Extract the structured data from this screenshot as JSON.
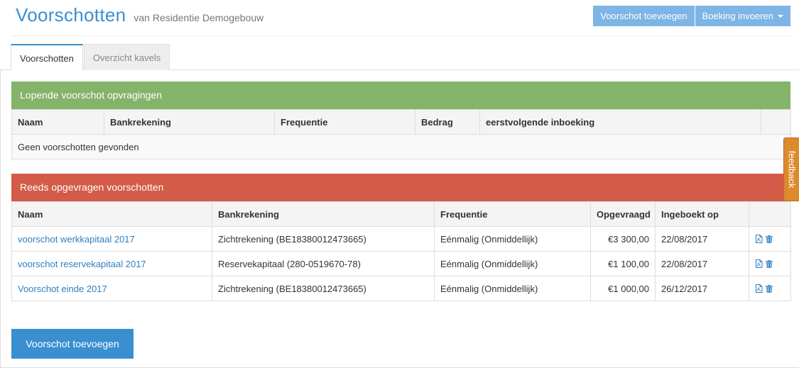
{
  "header": {
    "title": "Voorschotten",
    "subtitle": "van Residentie Demogebouw",
    "add_button": "Voorschot toevoegen",
    "booking_button": "Boeking invoeren"
  },
  "tabs": [
    {
      "label": "Voorschotten",
      "active": true
    },
    {
      "label": "Overzicht kavels",
      "active": false
    }
  ],
  "running": {
    "title": "Lopende voorschot opvragingen",
    "columns": [
      "Naam",
      "Bankrekening",
      "Frequentie",
      "Bedrag",
      "eerstvolgende inboeking"
    ],
    "empty_text": "Geen voorschotten gevonden"
  },
  "requested": {
    "title": "Reeds opgevragen voorschotten",
    "columns": [
      "Naam",
      "Bankrekening",
      "Frequentie",
      "Opgevraagd",
      "Ingeboekt op"
    ],
    "rows": [
      {
        "name": "voorschot werkkapitaal 2017",
        "account": "Zichtrekening (BE18380012473665)",
        "frequency": "Eénmalig (Onmiddellijk)",
        "amount": "€3 300,00",
        "booked": "22/08/2017"
      },
      {
        "name": "voorschot reservekapitaal 2017",
        "account": "Reservekapitaal (280-0519670-78)",
        "frequency": "Eénmalig (Onmiddellijk)",
        "amount": "€1 100,00",
        "booked": "22/08/2017"
      },
      {
        "name": "Voorschot einde 2017",
        "account": "Zichtrekening (BE18380012473665)",
        "frequency": "Eénmalig (Onmiddellijk)",
        "amount": "€1 000,00",
        "booked": "26/12/2017"
      }
    ]
  },
  "footer": {
    "add_button": "Voorschot toevoegen"
  },
  "feedback": {
    "label": "feedback"
  },
  "icons": {
    "pdf": "pdf-file-icon",
    "delete": "trash-icon",
    "caret": "caret-down-icon"
  },
  "colors": {
    "accent": "#3a8fd0",
    "green_panel": "#84b36a",
    "red_panel": "#d35b47",
    "feedback": "#dd8a2c"
  }
}
